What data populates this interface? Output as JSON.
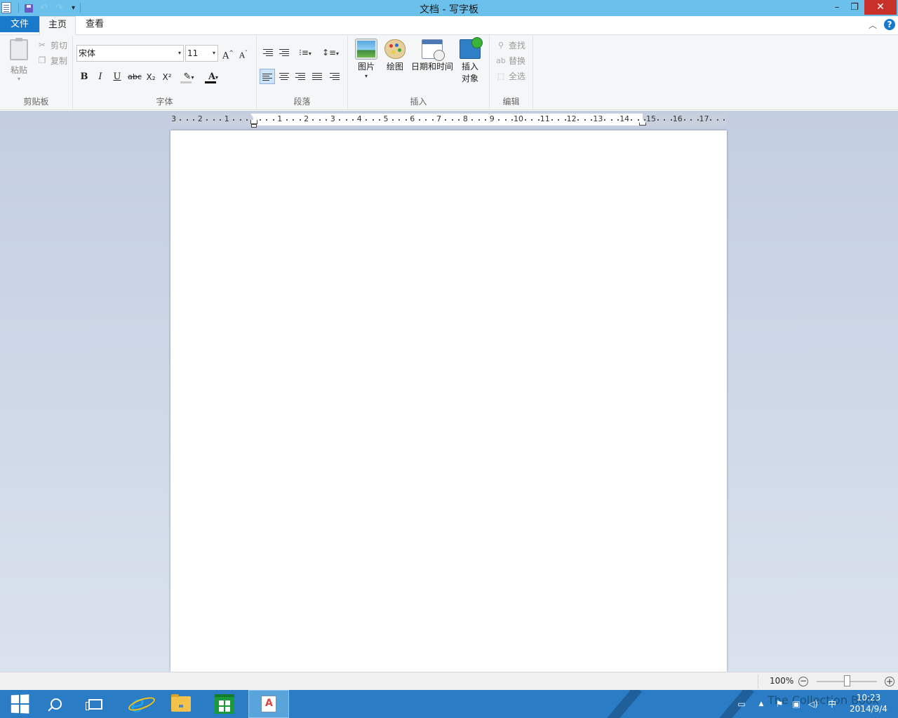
{
  "window": {
    "title": "文档 - 写字板",
    "minimize": "–",
    "maximize": "❐",
    "close": "✕"
  },
  "quick_access": {
    "undo": "↶",
    "redo": "↷",
    "customize": "▾"
  },
  "tabs": {
    "file": "文件",
    "home": "主页",
    "view": "查看",
    "help": "?"
  },
  "clipboard": {
    "group_label": "剪贴板",
    "paste": "粘贴",
    "cut": "剪切",
    "copy": "复制"
  },
  "font": {
    "group_label": "字体",
    "name": "宋体",
    "size": "11",
    "grow": "A",
    "shrink": "A",
    "bold": "B",
    "italic": "I",
    "underline": "U",
    "strikethrough": "abc",
    "subscript": "X₂",
    "superscript": "X²",
    "highlight_color": "#c8c8c8",
    "font_color": "#000000"
  },
  "paragraph": {
    "group_label": "段落"
  },
  "insert": {
    "group_label": "插入",
    "picture": "图片",
    "paint": "绘图",
    "datetime": "日期和时间",
    "object_line1": "插入",
    "object_line2": "对象"
  },
  "editing": {
    "group_label": "编辑",
    "find": "查找",
    "replace": "替换",
    "select_all": "全选"
  },
  "ruler": {
    "left_labels": [
      "3",
      "2",
      "1"
    ],
    "labels": [
      "1",
      "2",
      "3",
      "4",
      "5",
      "6",
      "7",
      "8",
      "9",
      "10",
      "11",
      "12",
      "13",
      "14",
      "15",
      "16",
      "17"
    ]
  },
  "statusbar": {
    "zoom": "100%",
    "zoom_out": "−",
    "zoom_in": "+",
    "zoom_level": 0.5
  },
  "taskbar": {
    "ime": "中",
    "time": "10:23",
    "date": "2014/9/4",
    "watermark": "The Collection Book"
  }
}
